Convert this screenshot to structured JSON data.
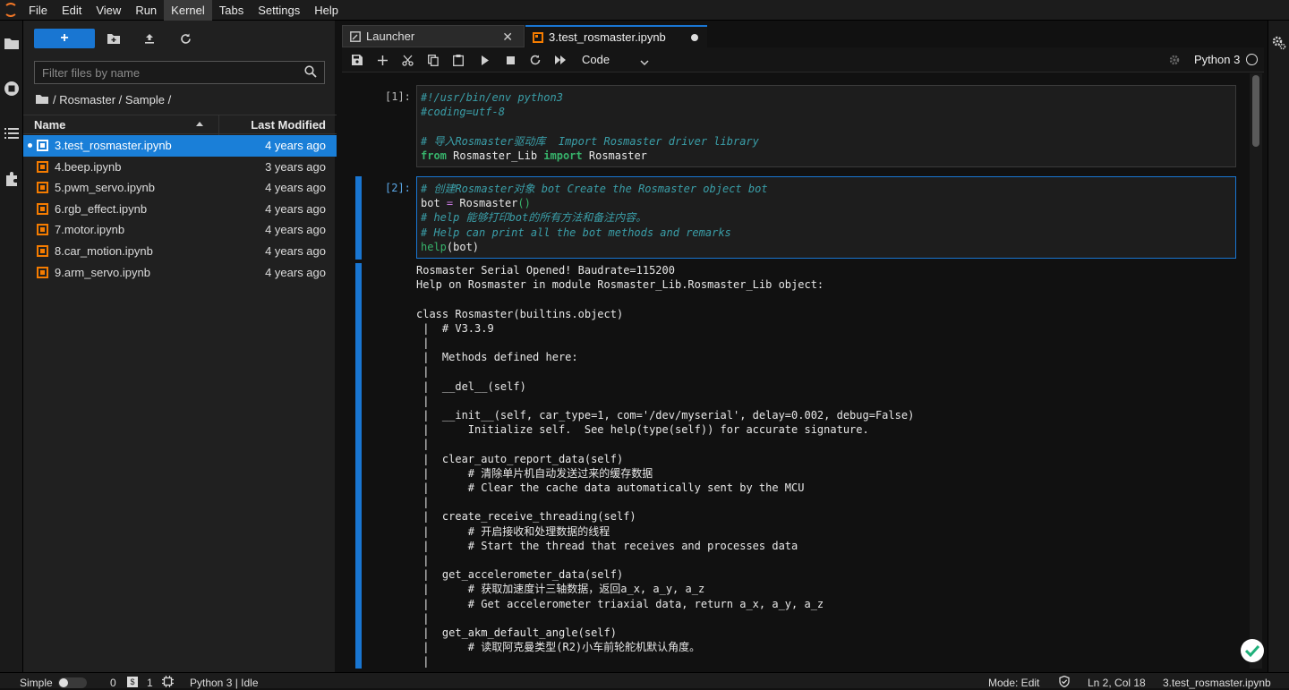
{
  "menu": {
    "items": [
      "File",
      "Edit",
      "View",
      "Run",
      "Kernel",
      "Tabs",
      "Settings",
      "Help"
    ],
    "active": "Kernel"
  },
  "filebrowser": {
    "new_label": "+",
    "search_placeholder": "Filter files by name",
    "breadcrumb": "/ Rosmaster / Sample /",
    "col_name": "Name",
    "col_modified": "Last Modified",
    "files": [
      {
        "name": "3.test_rosmaster.ipynb",
        "modified": "4 years ago",
        "selected": true
      },
      {
        "name": "4.beep.ipynb",
        "modified": "3 years ago"
      },
      {
        "name": "5.pwm_servo.ipynb",
        "modified": "4 years ago"
      },
      {
        "name": "6.rgb_effect.ipynb",
        "modified": "4 years ago"
      },
      {
        "name": "7.motor.ipynb",
        "modified": "4 years ago"
      },
      {
        "name": "8.car_motion.ipynb",
        "modified": "4 years ago"
      },
      {
        "name": "9.arm_servo.ipynb",
        "modified": "4 years ago"
      }
    ]
  },
  "tabs": {
    "launcher": "Launcher",
    "notebook": "3.test_rosmaster.ipynb",
    "close_glyph": "✕"
  },
  "toolbar": {
    "cell_type": "Code",
    "kernel": "Python 3"
  },
  "cells": {
    "c1": {
      "prompt": "[1]:",
      "line1": "#!/usr/bin/env python3",
      "line2": "#coding=utf-8",
      "line3": "# 导入Rosmaster驱动库  Import Rosmaster driver library",
      "line4_kw1": "from",
      "line4_mod": " Rosmaster_Lib ",
      "line4_kw2": "import",
      "line4_name": " Rosmaster"
    },
    "c2": {
      "prompt": "[2]:",
      "line1": "# 创建Rosmaster对象 bot Create the Rosmaster object bot",
      "line2_a": "bot ",
      "line2_op": "=",
      "line2_b": " Rosmaster",
      "line2_paren": "()",
      "line3": "# help 能够打印bot的所有方法和备注内容。",
      "line4": "# Help can print all the bot methods and remarks",
      "line5_fn": "help",
      "line5_rest": "(bot)"
    },
    "output": "Rosmaster Serial Opened! Baudrate=115200\nHelp on Rosmaster in module Rosmaster_Lib.Rosmaster_Lib object:\n\nclass Rosmaster(builtins.object)\n |  # V3.3.9\n |  \n |  Methods defined here:\n |  \n |  __del__(self)\n |  \n |  __init__(self, car_type=1, com='/dev/myserial', delay=0.002, debug=False)\n |      Initialize self.  See help(type(self)) for accurate signature.\n |  \n |  clear_auto_report_data(self)\n |      # 清除单片机自动发送过来的缓存数据\n |      # Clear the cache data automatically sent by the MCU\n |  \n |  create_receive_threading(self)\n |      # 开启接收和处理数据的线程\n |      # Start the thread that receives and processes data\n |  \n |  get_accelerometer_data(self)\n |      # 获取加速度计三轴数据，返回a_x, a_y, a_z\n |      # Get accelerometer triaxial data, return a_x, a_y, a_z\n |  \n |  get_akm_default_angle(self)\n |      # 读取阿克曼类型(R2)小车前轮舵机默认角度。\n |  "
  },
  "status": {
    "mode_label": "Simple",
    "count_a": "0",
    "count_b": "1",
    "kernel_status": "Python 3 | Idle",
    "edit_mode": "Mode: Edit",
    "cursor": "Ln 2, Col 18",
    "filename": "3.test_rosmaster.ipynb"
  },
  "colors": {
    "accent": "#1976d2",
    "notebook_icon": "#f57c00"
  }
}
